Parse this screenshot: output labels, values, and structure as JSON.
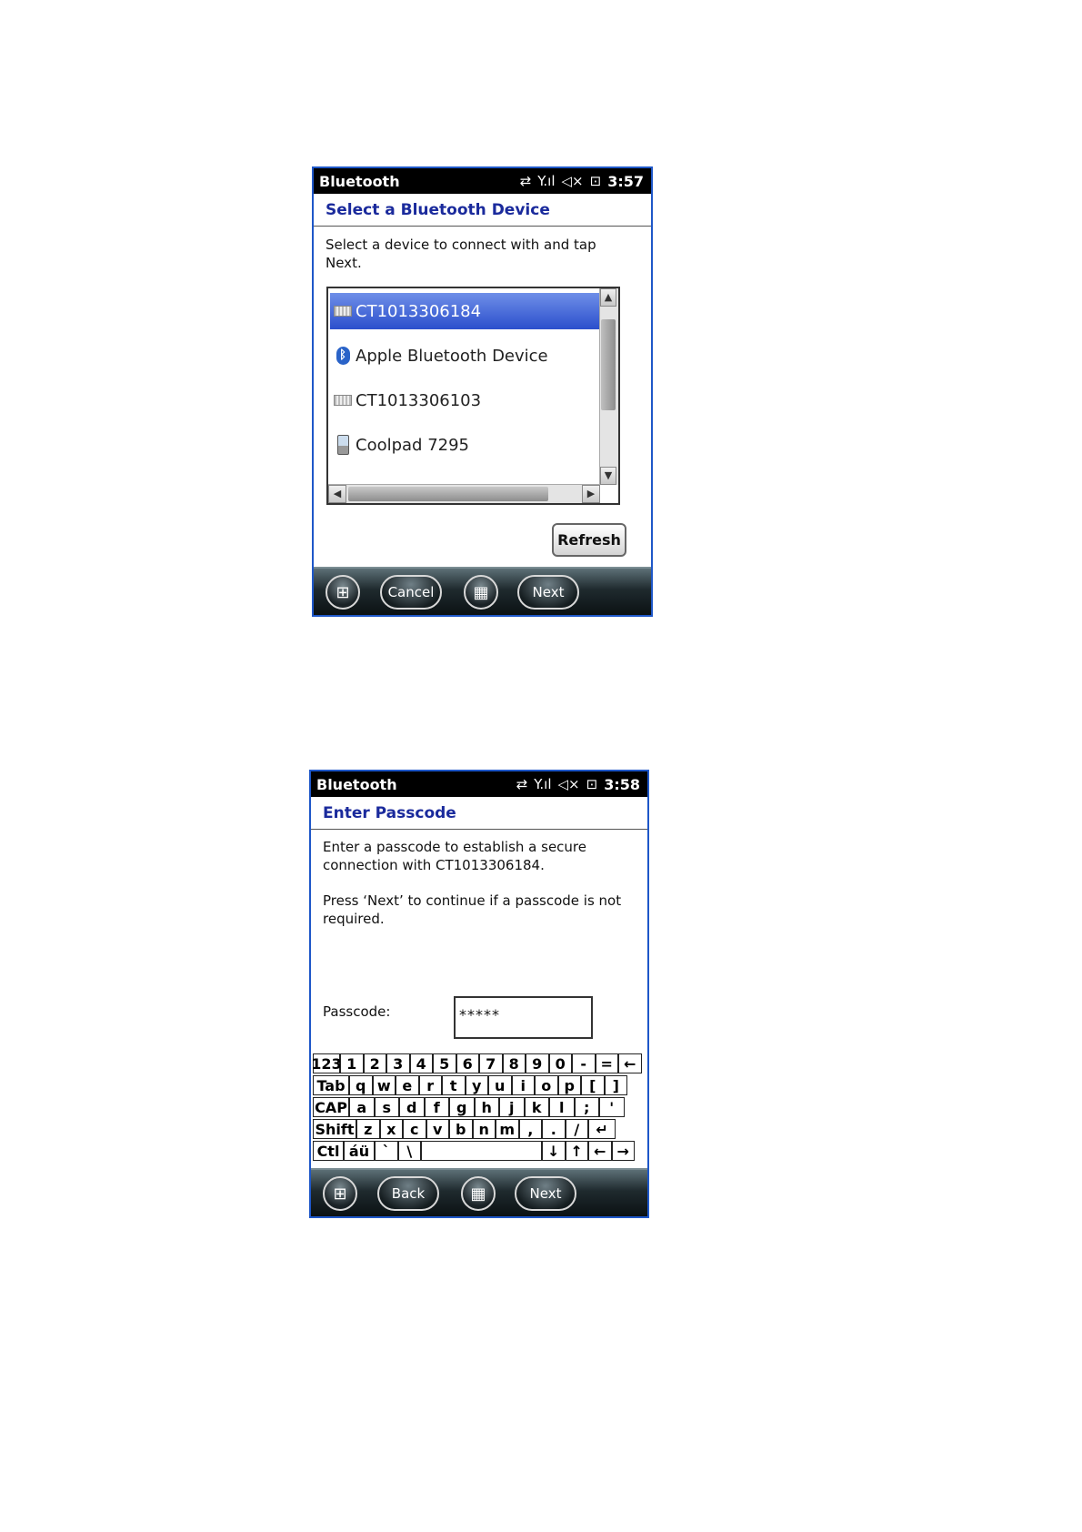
{
  "screen1": {
    "status": {
      "title": "Bluetooth",
      "time": "3:57"
    },
    "header": "Select a Bluetooth Device",
    "instruction_line1": "Select a device to connect with and tap",
    "instruction_line2": "Next.",
    "devices": [
      {
        "label": "CT1013306184",
        "icon": "keyboard-icon",
        "selected": true
      },
      {
        "label": "Apple Bluetooth Device",
        "icon": "bluetooth-icon",
        "selected": false
      },
      {
        "label": "CT1013306103",
        "icon": "keyboard-icon",
        "selected": false
      },
      {
        "label": "Coolpad 7295",
        "icon": "phone-icon",
        "selected": false
      }
    ],
    "refresh_label": "Refresh",
    "taskbar": {
      "left_label": "Cancel",
      "right_label": "Next"
    }
  },
  "screen2": {
    "status": {
      "title": "Bluetooth",
      "time": "3:58"
    },
    "header": "Enter Passcode",
    "text1_line1": "Enter a passcode to establish a secure",
    "text1_line2": "connection with CT1013306184.",
    "text2_line1": "Press ‘Next’ to continue if a passcode is not",
    "text2_line2": "required.",
    "passcode_label": "Passcode:",
    "passcode_value": "*****",
    "keyboard_rows": [
      [
        "123",
        "1",
        "2",
        "3",
        "4",
        "5",
        "6",
        "7",
        "8",
        "9",
        "0",
        "-",
        "=",
        "←"
      ],
      [
        "Tab",
        "q",
        "w",
        "e",
        "r",
        "t",
        "y",
        "u",
        "i",
        "o",
        "p",
        "[",
        "]"
      ],
      [
        "CAP",
        "a",
        "s",
        "d",
        "f",
        "g",
        "h",
        "j",
        "k",
        "l",
        ";",
        "'"
      ],
      [
        "Shift",
        "z",
        "x",
        "c",
        "v",
        "b",
        "n",
        "m",
        ",",
        ".",
        "/",
        "↵"
      ],
      [
        "Ctl",
        "áü",
        "`",
        "\\",
        " ",
        "↓",
        "↑",
        "←",
        "→"
      ]
    ],
    "taskbar": {
      "left_label": "Back",
      "right_label": "Next"
    }
  },
  "colors": {
    "header_text": "#1a2a9c",
    "selection": "#2b4fcc",
    "frame": "#1e57c8"
  }
}
